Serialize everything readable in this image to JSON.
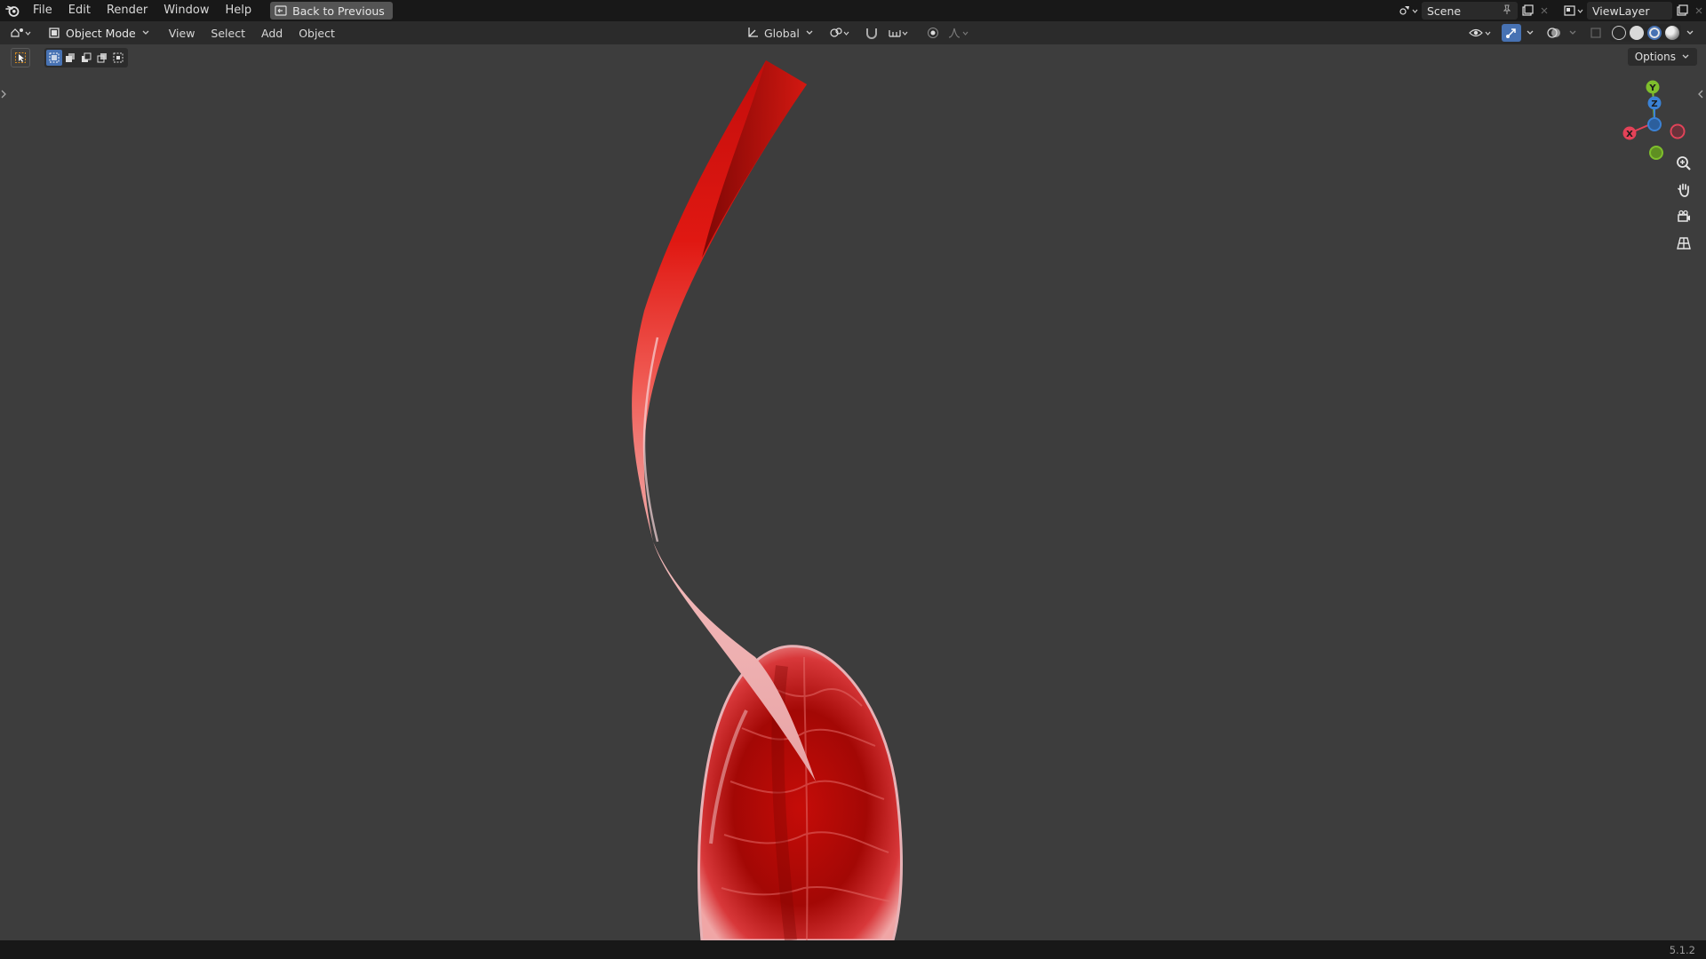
{
  "topbar": {
    "menus": [
      "File",
      "Edit",
      "Render",
      "Window",
      "Help"
    ],
    "back_label": "Back to Previous",
    "scene_name": "Scene",
    "view_layer": "ViewLayer"
  },
  "header": {
    "mode": "Object Mode",
    "menus": [
      "View",
      "Select",
      "Add",
      "Object"
    ],
    "orientation": "Global"
  },
  "viewport": {
    "options_label": "Options",
    "gizmo_labels": {
      "x": "X",
      "y": "Y",
      "z": "Z"
    },
    "colors": {
      "background": "#3d3d3d",
      "object_red": "#d8100e",
      "axis_x": "#e44258",
      "axis_y": "#7fbf2c",
      "axis_z": "#3b82d6",
      "accent": "#4772b3"
    }
  },
  "status": {
    "version": "5.1.2"
  }
}
